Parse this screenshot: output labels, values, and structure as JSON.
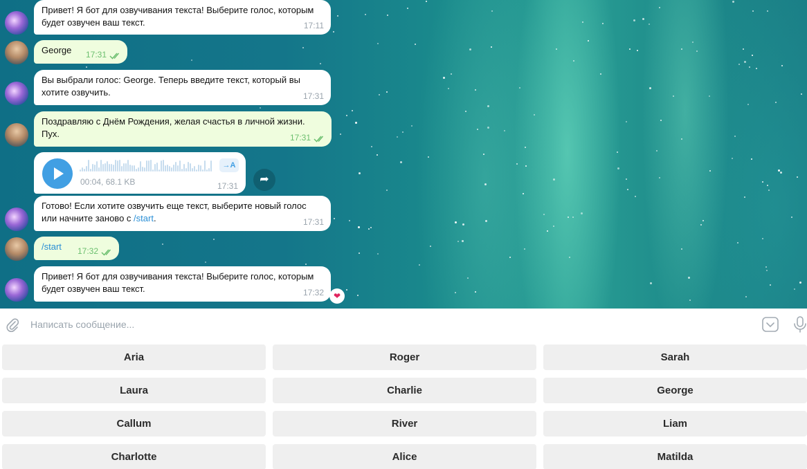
{
  "messages": {
    "m1": {
      "text": "Привет! Я бот для озвучивания текста! Выберите голос, которым будет озвучен ваш текст.",
      "time": "17:11"
    },
    "m2": {
      "text": "George",
      "time": "17:31"
    },
    "m3": {
      "text": "Вы выбрали голос: George. Теперь введите текст, который вы хотите озвучить.",
      "time": "17:31"
    },
    "m4": {
      "text": "Поздравляю с Днём Рождения, желая счастья в личной жизни. Пух.",
      "time": "17:31"
    },
    "voice": {
      "meta": "00:04, 68.1 KB",
      "time": "17:31",
      "transcribe_label": "→A"
    },
    "m6": {
      "text_before": "Готово! Если хотите озвучить еще текст, выберите новый голос или начните заново с ",
      "link": "/start",
      "text_after": ".",
      "time": "17:31"
    },
    "m7": {
      "text": "/start",
      "time": "17:32"
    },
    "m8": {
      "text": "Привет! Я бот для озвучивания текста! Выберите голос, которым будет озвучен ваш текст.",
      "time": "17:32",
      "reaction": "❤"
    }
  },
  "composer": {
    "placeholder": "Написать сообщение..."
  },
  "keyboard": {
    "row1": [
      "Aria",
      "Roger",
      "Sarah"
    ],
    "row2": [
      "Laura",
      "Charlie",
      "George"
    ],
    "row3": [
      "Callum",
      "River",
      "Liam"
    ],
    "row4": [
      "Charlotte",
      "Alice",
      "Matilda"
    ]
  },
  "colors": {
    "accent": "#419fe3",
    "outgoing_bubble": "#effdde",
    "check": "#6cbf6f"
  },
  "icons": {
    "attach": "paperclip-icon",
    "keyboard": "keyboard-toggle-icon",
    "mic": "microphone-icon",
    "share": "share-arrow-icon",
    "play": "play-icon"
  }
}
